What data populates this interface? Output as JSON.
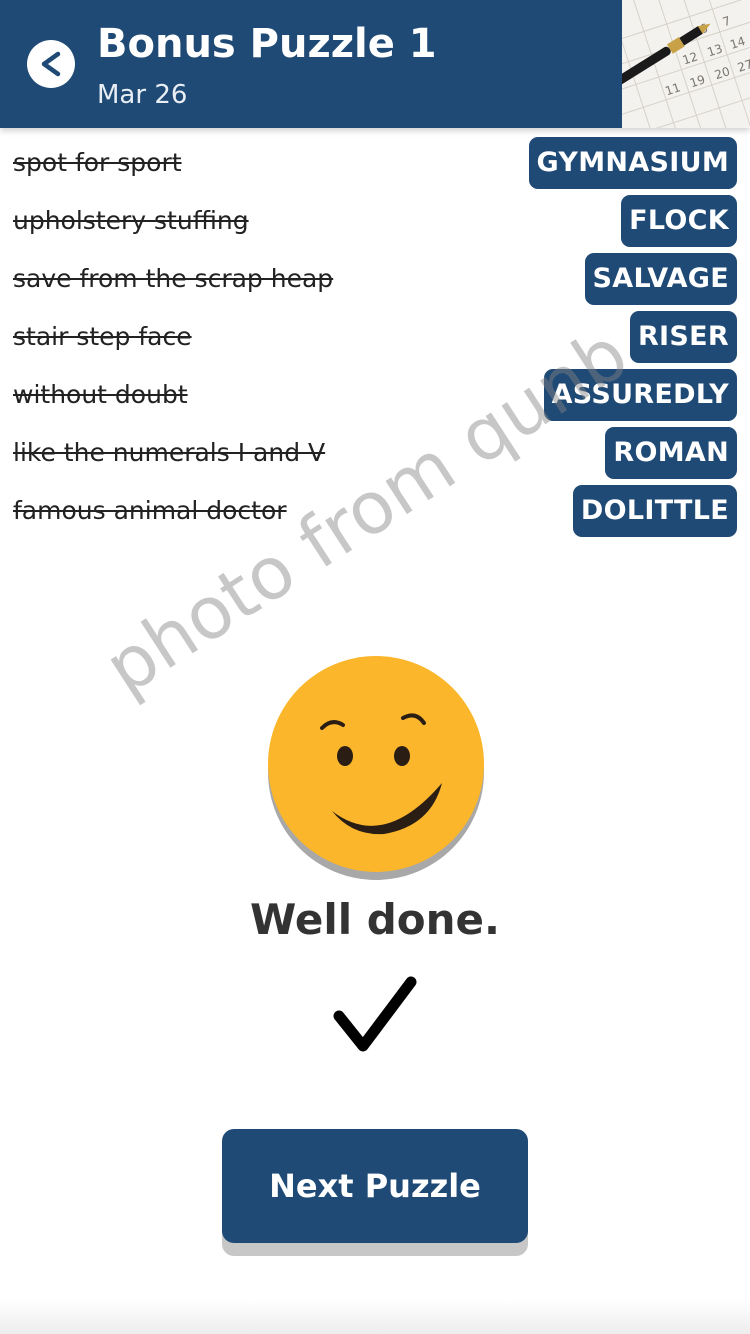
{
  "header": {
    "title": "Bonus Puzzle 1",
    "date": "Mar 26",
    "back_icon": "chevron-left-icon",
    "background_color": "#1f4a75"
  },
  "clues": [
    {
      "clue": "spot for sport",
      "answer": "GYMNASIUM"
    },
    {
      "clue": "upholstery stuffing",
      "answer": "FLOCK"
    },
    {
      "clue": "save from the scrap heap",
      "answer": "SALVAGE"
    },
    {
      "clue": "stair step face",
      "answer": "RISER"
    },
    {
      "clue": "without doubt",
      "answer": "ASSUREDLY"
    },
    {
      "clue": "like the numerals I and V",
      "answer": "ROMAN"
    },
    {
      "clue": "famous animal doctor",
      "answer": "DOLITTLE"
    }
  ],
  "watermark": "photo from qunb",
  "result": {
    "icon": "smiley-face-icon",
    "message": "Well done.",
    "check_icon": "checkmark-icon"
  },
  "next_button": {
    "label": "Next Puzzle"
  },
  "colors": {
    "accent": "#1f4a75",
    "smiley": "#fbb62c"
  }
}
